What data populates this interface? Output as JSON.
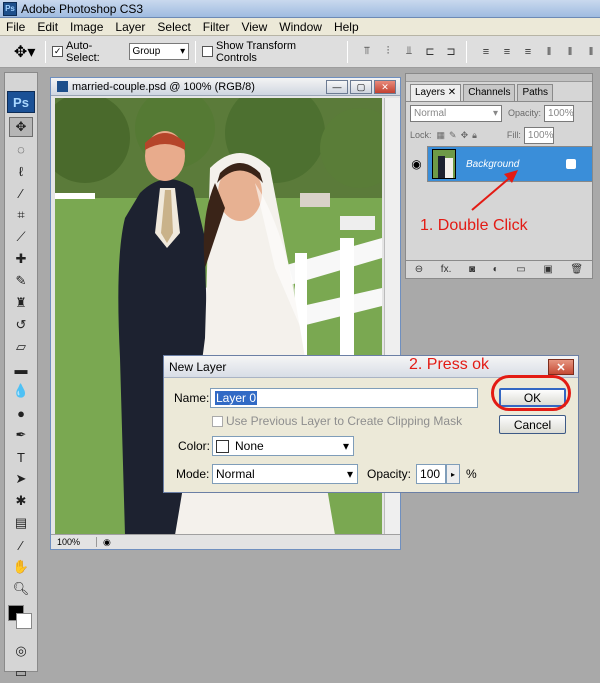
{
  "app": {
    "title": "Adobe Photoshop CS3",
    "logo": "Ps"
  },
  "menu": [
    "File",
    "Edit",
    "Image",
    "Layer",
    "Select",
    "Filter",
    "View",
    "Window",
    "Help"
  ],
  "options_bar": {
    "move_tool": "move-tool-icon",
    "auto_select_label": "Auto-Select:",
    "auto_select_checked": true,
    "auto_select_value": "Group",
    "show_transform_label": "Show Transform Controls",
    "show_transform_checked": false
  },
  "toolbox": {
    "logo": "Ps",
    "tools": [
      "move-icon",
      "marquee-icon",
      "lasso-icon",
      "magic-wand-icon",
      "crop-icon",
      "slice-icon",
      "healing-icon",
      "brush-icon",
      "stamp-icon",
      "history-brush-icon",
      "eraser-icon",
      "gradient-icon",
      "blur-icon",
      "dodge-icon",
      "pen-icon",
      "type-icon",
      "path-select-icon",
      "shape-icon",
      "notes-icon",
      "eyedropper-icon",
      "hand-icon",
      "zoom-icon"
    ],
    "foreground_color": "#000000",
    "background_color": "#ffffff"
  },
  "document": {
    "title": "married-couple.psd @ 100% (RGB/8)",
    "zoom": "100%"
  },
  "layers_panel": {
    "tabs": [
      "Layers",
      "Channels",
      "Paths"
    ],
    "active_tab": "Layers",
    "blend_mode": "Normal",
    "opacity_label": "Opacity:",
    "opacity_value": "100%",
    "lock_label": "Lock:",
    "fill_label": "Fill:",
    "fill_value": "100%",
    "layer_name": "Background",
    "footer_icons": [
      "link-icon",
      "fx-icon",
      "mask-icon",
      "adjustment-icon",
      "group-icon",
      "new-layer-icon",
      "trash-icon"
    ],
    "fx_label": "fx."
  },
  "annotations": {
    "step1": "1. Double Click",
    "step2": "2. Press ok",
    "color": "#e31b14"
  },
  "dialog": {
    "title": "New Layer",
    "name_label": "Name:",
    "name_value": "Layer 0",
    "clip_label": "Use Previous Layer to Create Clipping Mask",
    "color_label": "Color:",
    "color_value": "None",
    "mode_label": "Mode:",
    "mode_value": "Normal",
    "opacity_label": "Opacity:",
    "opacity_value": "100",
    "percent": "%",
    "ok_label": "OK",
    "cancel_label": "Cancel"
  }
}
